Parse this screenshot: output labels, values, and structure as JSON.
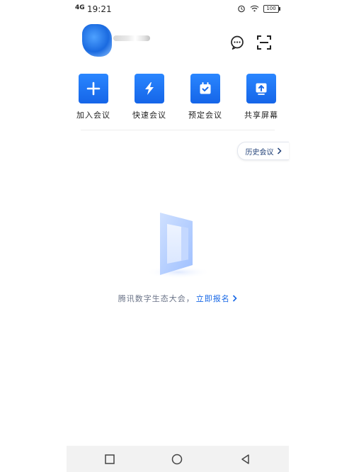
{
  "status_bar": {
    "signal": "4G",
    "time": "19:21",
    "battery": "100"
  },
  "actions": [
    {
      "label": "加入会议",
      "icon": "plus-icon"
    },
    {
      "label": "快速会议",
      "icon": "lightning-icon"
    },
    {
      "label": "预定会议",
      "icon": "calendar-check-icon"
    },
    {
      "label": "共享屏幕",
      "icon": "share-screen-icon"
    }
  ],
  "history": {
    "label": "历史会议"
  },
  "promo": {
    "text": "腾讯数字生态大会，",
    "link": "立即报名"
  },
  "colors": {
    "accent": "#1667e6",
    "tile_gradient_top": "#2a86ff",
    "tile_gradient_bottom": "#1565e8",
    "navbar_bg": "#f2f2f2"
  }
}
